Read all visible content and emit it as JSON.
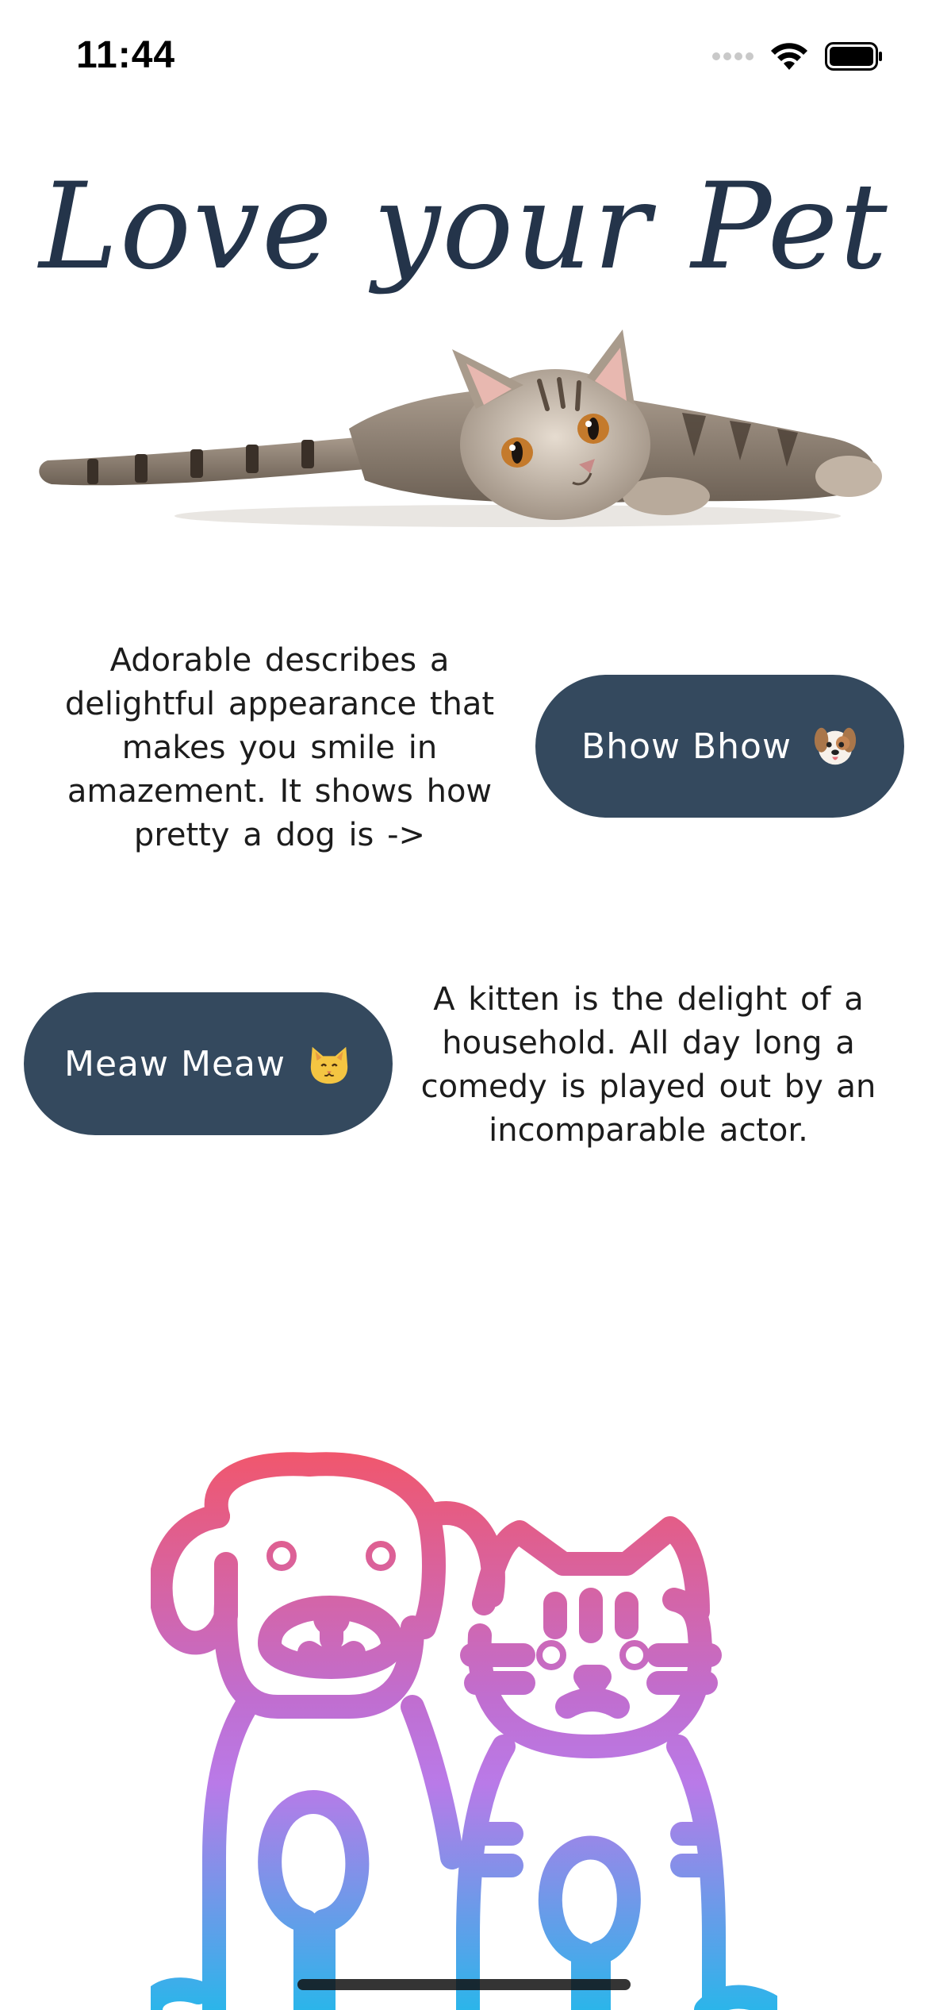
{
  "status_bar": {
    "time": "11:44",
    "icons": [
      "cellular-dots-icon",
      "wifi-icon",
      "battery-icon"
    ]
  },
  "header": {
    "title": "Love your Pet"
  },
  "hero": {
    "image": "lying-kitten-illustration"
  },
  "dog_section": {
    "description": "Adorable describes a delightful appearance that makes you smile in amazement. It shows how pretty a dog is ->",
    "button_label": "Bhow Bhow",
    "button_icon": "dog-face-emoji"
  },
  "cat_section": {
    "description": "A kitten is the delight of a household. All day long a comedy is played out by an incomparable actor.",
    "button_label": "Meaw Meaw",
    "button_icon": "cat-face-emoji"
  },
  "footer_art": {
    "image": "dog-and-cat-line-illustration",
    "gradient_top": "#f2566a",
    "gradient_mid": "#c175e8",
    "gradient_bottom": "#2bb5ea"
  },
  "colors": {
    "button_bg": "#34495e",
    "title_color": "#24344a"
  }
}
